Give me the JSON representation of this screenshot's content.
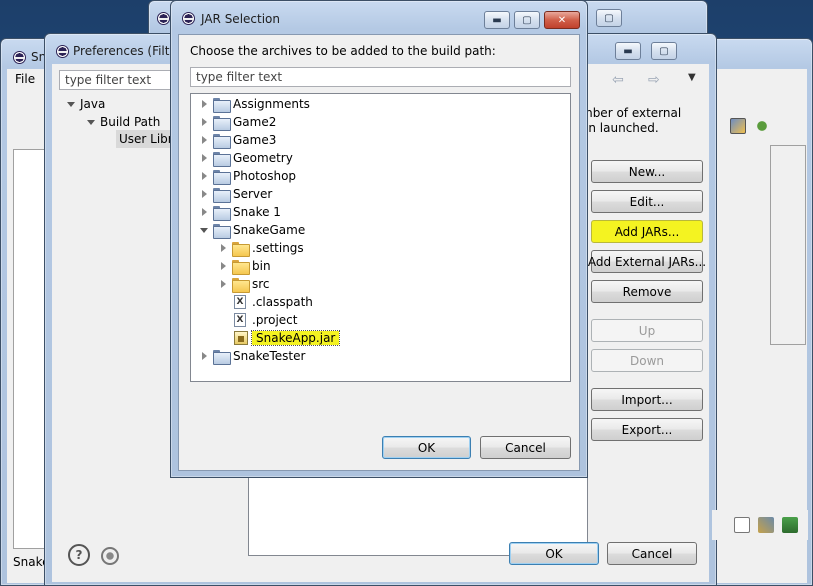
{
  "eclipse_window": {
    "title_fragment": "Sn",
    "menu_file": "File",
    "status_label": "Snake"
  },
  "preferences": {
    "title": "Preferences (Filtere",
    "filter_placeholder": "type filter text",
    "tree": [
      {
        "label": "Java",
        "level": 0,
        "expanded": true
      },
      {
        "label": "Build Path",
        "level": 1,
        "expanded": true
      },
      {
        "label": "User Libra",
        "level": 2,
        "selected": true
      }
    ],
    "ok_label": "OK",
    "cancel_label": "Cancel"
  },
  "library_panel": {
    "desc_line1": "mber of external",
    "desc_line2": "en launched.",
    "buttons": [
      {
        "label": "New...",
        "enabled": true
      },
      {
        "label": "Edit...",
        "enabled": true
      },
      {
        "label": "Add JARs...",
        "enabled": true,
        "highlight": true
      },
      {
        "label": "Add External JARs...",
        "enabled": true
      },
      {
        "label": "Remove",
        "enabled": true
      },
      {
        "label": "Up",
        "enabled": false
      },
      {
        "label": "Down",
        "enabled": false
      },
      {
        "label": "Import...",
        "enabled": true
      },
      {
        "label": "Export...",
        "enabled": true
      }
    ]
  },
  "jar_dialog": {
    "title": "JAR Selection",
    "prompt": "Choose the archives to be added to the build path:",
    "filter_placeholder": "type filter text",
    "tree": [
      {
        "label": "Assignments",
        "type": "project",
        "level": 0,
        "twisty": "closed"
      },
      {
        "label": "Game2",
        "type": "project",
        "level": 0,
        "twisty": "closed"
      },
      {
        "label": "Game3",
        "type": "project",
        "level": 0,
        "twisty": "closed"
      },
      {
        "label": "Geometry",
        "type": "project",
        "level": 0,
        "twisty": "closed"
      },
      {
        "label": "Photoshop",
        "type": "project",
        "level": 0,
        "twisty": "closed"
      },
      {
        "label": "Server",
        "type": "project",
        "level": 0,
        "twisty": "closed"
      },
      {
        "label": "Snake 1",
        "type": "project",
        "level": 0,
        "twisty": "closed"
      },
      {
        "label": "SnakeGame",
        "type": "project",
        "level": 0,
        "twisty": "open"
      },
      {
        "label": ".settings",
        "type": "folder",
        "level": 1,
        "twisty": "closed"
      },
      {
        "label": "bin",
        "type": "folder",
        "level": 1,
        "twisty": "closed"
      },
      {
        "label": "src",
        "type": "folder",
        "level": 1,
        "twisty": "closed"
      },
      {
        "label": ".classpath",
        "type": "xfile",
        "level": 1,
        "twisty": "none"
      },
      {
        "label": ".project",
        "type": "xfile",
        "level": 1,
        "twisty": "none"
      },
      {
        "label": "SnakeApp.jar",
        "type": "jar",
        "level": 1,
        "twisty": "none",
        "selected": true
      },
      {
        "label": "SnakeTester",
        "type": "project",
        "level": 0,
        "twisty": "closed"
      }
    ],
    "ok_label": "OK",
    "cancel_label": "Cancel",
    "caption_minimize": "▬",
    "caption_maximize": "▢",
    "caption_close": "✕"
  },
  "colors": {
    "highlight": "#f4f321",
    "desktop": "#1f4e80"
  }
}
